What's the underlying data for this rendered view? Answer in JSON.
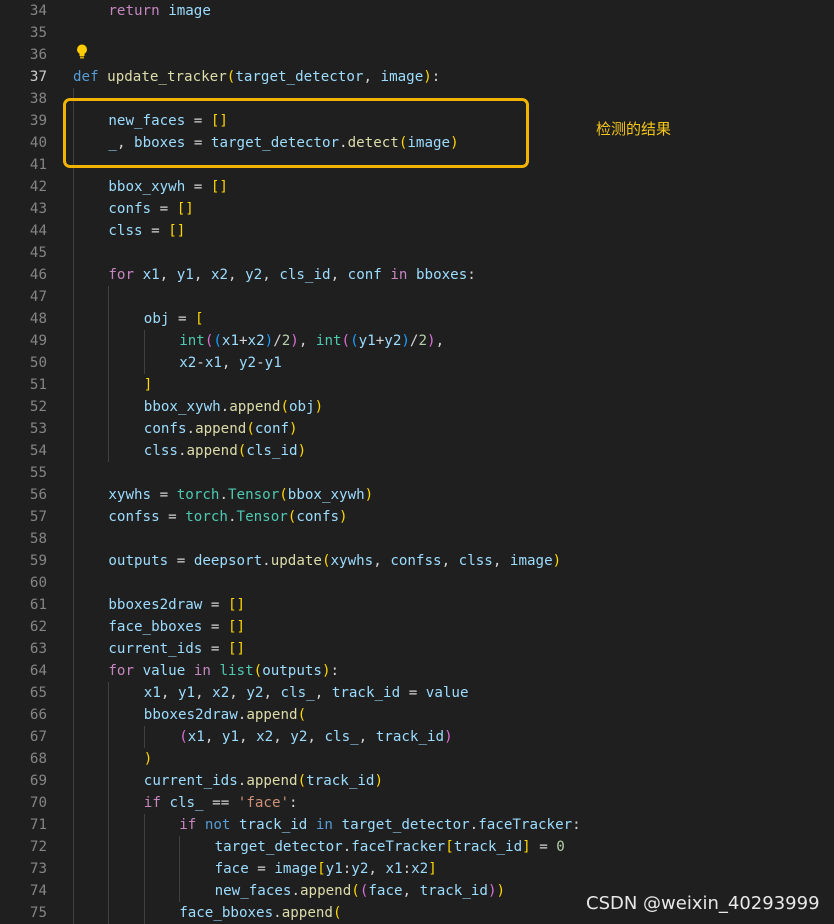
{
  "editor": {
    "theme_colors": {
      "background": "#1f1f1f",
      "keyword": "#569cd6",
      "control": "#c586c0",
      "function": "#dcdcaa",
      "variable": "#9cdcfe",
      "class": "#4ec9b0",
      "number": "#b5cea8",
      "string": "#ce9178",
      "bracket_1": "#ffd700",
      "bracket_2": "#da70d6",
      "bracket_3": "#179fff",
      "highlight_box": "#f0b400"
    },
    "active_line": 37,
    "lines": [
      {
        "n": "34",
        "indent": 1,
        "tokens": [
          [
            "ctrl",
            "return"
          ],
          [
            "op",
            " "
          ],
          [
            "var",
            "image"
          ]
        ]
      },
      {
        "n": "35",
        "indent": 0,
        "tokens": []
      },
      {
        "n": "36",
        "indent": 0,
        "tokens": []
      },
      {
        "n": "37",
        "indent": 0,
        "tokens": [
          [
            "kw",
            "def"
          ],
          [
            "op",
            " "
          ],
          [
            "fn",
            "update_tracker"
          ],
          [
            "p1",
            "("
          ],
          [
            "var",
            "target_detector"
          ],
          [
            "op",
            ", "
          ],
          [
            "var",
            "image"
          ],
          [
            "p1",
            ")"
          ],
          [
            "op",
            ":"
          ]
        ]
      },
      {
        "n": "38",
        "indent": 1,
        "tokens": []
      },
      {
        "n": "39",
        "indent": 1,
        "tokens": [
          [
            "var",
            "new_faces"
          ],
          [
            "op",
            " = "
          ],
          [
            "p1",
            "[]"
          ]
        ]
      },
      {
        "n": "40",
        "indent": 1,
        "tokens": [
          [
            "var",
            "_"
          ],
          [
            "op",
            ", "
          ],
          [
            "var",
            "bboxes"
          ],
          [
            "op",
            " = "
          ],
          [
            "var",
            "target_detector"
          ],
          [
            "op",
            "."
          ],
          [
            "fn",
            "detect"
          ],
          [
            "p1",
            "("
          ],
          [
            "var",
            "image"
          ],
          [
            "p1",
            ")"
          ]
        ]
      },
      {
        "n": "41",
        "indent": 1,
        "tokens": []
      },
      {
        "n": "42",
        "indent": 1,
        "tokens": [
          [
            "var",
            "bbox_xywh"
          ],
          [
            "op",
            " = "
          ],
          [
            "p1",
            "[]"
          ]
        ]
      },
      {
        "n": "43",
        "indent": 1,
        "tokens": [
          [
            "var",
            "confs"
          ],
          [
            "op",
            " = "
          ],
          [
            "p1",
            "[]"
          ]
        ]
      },
      {
        "n": "44",
        "indent": 1,
        "tokens": [
          [
            "var",
            "clss"
          ],
          [
            "op",
            " = "
          ],
          [
            "p1",
            "[]"
          ]
        ]
      },
      {
        "n": "45",
        "indent": 1,
        "tokens": []
      },
      {
        "n": "46",
        "indent": 1,
        "tokens": [
          [
            "ctrl",
            "for"
          ],
          [
            "op",
            " "
          ],
          [
            "var",
            "x1"
          ],
          [
            "op",
            ", "
          ],
          [
            "var",
            "y1"
          ],
          [
            "op",
            ", "
          ],
          [
            "var",
            "x2"
          ],
          [
            "op",
            ", "
          ],
          [
            "var",
            "y2"
          ],
          [
            "op",
            ", "
          ],
          [
            "var",
            "cls_id"
          ],
          [
            "op",
            ", "
          ],
          [
            "var",
            "conf"
          ],
          [
            "op",
            " "
          ],
          [
            "ctrl",
            "in"
          ],
          [
            "op",
            " "
          ],
          [
            "var",
            "bboxes"
          ],
          [
            "op",
            ":"
          ]
        ]
      },
      {
        "n": "47",
        "indent": 2,
        "tokens": []
      },
      {
        "n": "48",
        "indent": 2,
        "tokens": [
          [
            "var",
            "obj"
          ],
          [
            "op",
            " = "
          ],
          [
            "p1",
            "["
          ]
        ]
      },
      {
        "n": "49",
        "indent": 3,
        "tokens": [
          [
            "cls",
            "int"
          ],
          [
            "p2",
            "("
          ],
          [
            "p3",
            "("
          ],
          [
            "var",
            "x1"
          ],
          [
            "op",
            "+"
          ],
          [
            "var",
            "x2"
          ],
          [
            "p3",
            ")"
          ],
          [
            "op",
            "/"
          ],
          [
            "num",
            "2"
          ],
          [
            "p2",
            ")"
          ],
          [
            "op",
            ", "
          ],
          [
            "cls",
            "int"
          ],
          [
            "p2",
            "("
          ],
          [
            "p3",
            "("
          ],
          [
            "var",
            "y1"
          ],
          [
            "op",
            "+"
          ],
          [
            "var",
            "y2"
          ],
          [
            "p3",
            ")"
          ],
          [
            "op",
            "/"
          ],
          [
            "num",
            "2"
          ],
          [
            "p2",
            ")"
          ],
          [
            "op",
            ","
          ]
        ]
      },
      {
        "n": "50",
        "indent": 3,
        "tokens": [
          [
            "var",
            "x2"
          ],
          [
            "op",
            "-"
          ],
          [
            "var",
            "x1"
          ],
          [
            "op",
            ", "
          ],
          [
            "var",
            "y2"
          ],
          [
            "op",
            "-"
          ],
          [
            "var",
            "y1"
          ]
        ]
      },
      {
        "n": "51",
        "indent": 2,
        "tokens": [
          [
            "p1",
            "]"
          ]
        ]
      },
      {
        "n": "52",
        "indent": 2,
        "tokens": [
          [
            "var",
            "bbox_xywh"
          ],
          [
            "op",
            "."
          ],
          [
            "fn",
            "append"
          ],
          [
            "p1",
            "("
          ],
          [
            "var",
            "obj"
          ],
          [
            "p1",
            ")"
          ]
        ]
      },
      {
        "n": "53",
        "indent": 2,
        "tokens": [
          [
            "var",
            "confs"
          ],
          [
            "op",
            "."
          ],
          [
            "fn",
            "append"
          ],
          [
            "p1",
            "("
          ],
          [
            "var",
            "conf"
          ],
          [
            "p1",
            ")"
          ]
        ]
      },
      {
        "n": "54",
        "indent": 2,
        "tokens": [
          [
            "var",
            "clss"
          ],
          [
            "op",
            "."
          ],
          [
            "fn",
            "append"
          ],
          [
            "p1",
            "("
          ],
          [
            "var",
            "cls_id"
          ],
          [
            "p1",
            ")"
          ]
        ]
      },
      {
        "n": "55",
        "indent": 1,
        "tokens": []
      },
      {
        "n": "56",
        "indent": 1,
        "tokens": [
          [
            "var",
            "xywhs"
          ],
          [
            "op",
            " = "
          ],
          [
            "cls",
            "torch"
          ],
          [
            "op",
            "."
          ],
          [
            "cls",
            "Tensor"
          ],
          [
            "p1",
            "("
          ],
          [
            "var",
            "bbox_xywh"
          ],
          [
            "p1",
            ")"
          ]
        ]
      },
      {
        "n": "57",
        "indent": 1,
        "tokens": [
          [
            "var",
            "confss"
          ],
          [
            "op",
            " = "
          ],
          [
            "cls",
            "torch"
          ],
          [
            "op",
            "."
          ],
          [
            "cls",
            "Tensor"
          ],
          [
            "p1",
            "("
          ],
          [
            "var",
            "confs"
          ],
          [
            "p1",
            ")"
          ]
        ]
      },
      {
        "n": "58",
        "indent": 1,
        "tokens": []
      },
      {
        "n": "59",
        "indent": 1,
        "tokens": [
          [
            "var",
            "outputs"
          ],
          [
            "op",
            " = "
          ],
          [
            "var",
            "deepsort"
          ],
          [
            "op",
            "."
          ],
          [
            "fn",
            "update"
          ],
          [
            "p1",
            "("
          ],
          [
            "var",
            "xywhs"
          ],
          [
            "op",
            ", "
          ],
          [
            "var",
            "confss"
          ],
          [
            "op",
            ", "
          ],
          [
            "var",
            "clss"
          ],
          [
            "op",
            ", "
          ],
          [
            "var",
            "image"
          ],
          [
            "p1",
            ")"
          ]
        ]
      },
      {
        "n": "60",
        "indent": 1,
        "tokens": []
      },
      {
        "n": "61",
        "indent": 1,
        "tokens": [
          [
            "var",
            "bboxes2draw"
          ],
          [
            "op",
            " = "
          ],
          [
            "p1",
            "[]"
          ]
        ]
      },
      {
        "n": "62",
        "indent": 1,
        "tokens": [
          [
            "var",
            "face_bboxes"
          ],
          [
            "op",
            " = "
          ],
          [
            "p1",
            "[]"
          ]
        ]
      },
      {
        "n": "63",
        "indent": 1,
        "tokens": [
          [
            "var",
            "current_ids"
          ],
          [
            "op",
            " = "
          ],
          [
            "p1",
            "[]"
          ]
        ]
      },
      {
        "n": "64",
        "indent": 1,
        "tokens": [
          [
            "ctrl",
            "for"
          ],
          [
            "op",
            " "
          ],
          [
            "var",
            "value"
          ],
          [
            "op",
            " "
          ],
          [
            "ctrl",
            "in"
          ],
          [
            "op",
            " "
          ],
          [
            "cls",
            "list"
          ],
          [
            "p1",
            "("
          ],
          [
            "var",
            "outputs"
          ],
          [
            "p1",
            ")"
          ],
          [
            "op",
            ":"
          ]
        ]
      },
      {
        "n": "65",
        "indent": 2,
        "tokens": [
          [
            "var",
            "x1"
          ],
          [
            "op",
            ", "
          ],
          [
            "var",
            "y1"
          ],
          [
            "op",
            ", "
          ],
          [
            "var",
            "x2"
          ],
          [
            "op",
            ", "
          ],
          [
            "var",
            "y2"
          ],
          [
            "op",
            ", "
          ],
          [
            "var",
            "cls_"
          ],
          [
            "op",
            ", "
          ],
          [
            "var",
            "track_id"
          ],
          [
            "op",
            " = "
          ],
          [
            "var",
            "value"
          ]
        ]
      },
      {
        "n": "66",
        "indent": 2,
        "tokens": [
          [
            "var",
            "bboxes2draw"
          ],
          [
            "op",
            "."
          ],
          [
            "fn",
            "append"
          ],
          [
            "p1",
            "("
          ]
        ]
      },
      {
        "n": "67",
        "indent": 3,
        "tokens": [
          [
            "p2",
            "("
          ],
          [
            "var",
            "x1"
          ],
          [
            "op",
            ", "
          ],
          [
            "var",
            "y1"
          ],
          [
            "op",
            ", "
          ],
          [
            "var",
            "x2"
          ],
          [
            "op",
            ", "
          ],
          [
            "var",
            "y2"
          ],
          [
            "op",
            ", "
          ],
          [
            "var",
            "cls_"
          ],
          [
            "op",
            ", "
          ],
          [
            "var",
            "track_id"
          ],
          [
            "p2",
            ")"
          ]
        ]
      },
      {
        "n": "68",
        "indent": 2,
        "tokens": [
          [
            "p1",
            ")"
          ]
        ]
      },
      {
        "n": "69",
        "indent": 2,
        "tokens": [
          [
            "var",
            "current_ids"
          ],
          [
            "op",
            "."
          ],
          [
            "fn",
            "append"
          ],
          [
            "p1",
            "("
          ],
          [
            "var",
            "track_id"
          ],
          [
            "p1",
            ")"
          ]
        ]
      },
      {
        "n": "70",
        "indent": 2,
        "tokens": [
          [
            "ctrl",
            "if"
          ],
          [
            "op",
            " "
          ],
          [
            "var",
            "cls_"
          ],
          [
            "op",
            " == "
          ],
          [
            "str",
            "'face'"
          ],
          [
            "op",
            ":"
          ]
        ]
      },
      {
        "n": "71",
        "indent": 3,
        "tokens": [
          [
            "ctrl",
            "if"
          ],
          [
            "op",
            " "
          ],
          [
            "kw",
            "not"
          ],
          [
            "op",
            " "
          ],
          [
            "var",
            "track_id"
          ],
          [
            "op",
            " "
          ],
          [
            "kw",
            "in"
          ],
          [
            "op",
            " "
          ],
          [
            "var",
            "target_detector"
          ],
          [
            "op",
            "."
          ],
          [
            "var",
            "faceTracker"
          ],
          [
            "op",
            ":"
          ]
        ]
      },
      {
        "n": "72",
        "indent": 4,
        "tokens": [
          [
            "var",
            "target_detector"
          ],
          [
            "op",
            "."
          ],
          [
            "var",
            "faceTracker"
          ],
          [
            "p1",
            "["
          ],
          [
            "var",
            "track_id"
          ],
          [
            "p1",
            "]"
          ],
          [
            "op",
            " = "
          ],
          [
            "num",
            "0"
          ]
        ]
      },
      {
        "n": "73",
        "indent": 4,
        "tokens": [
          [
            "var",
            "face"
          ],
          [
            "op",
            " = "
          ],
          [
            "var",
            "image"
          ],
          [
            "p1",
            "["
          ],
          [
            "var",
            "y1"
          ],
          [
            "op",
            ":"
          ],
          [
            "var",
            "y2"
          ],
          [
            "op",
            ", "
          ],
          [
            "var",
            "x1"
          ],
          [
            "op",
            ":"
          ],
          [
            "var",
            "x2"
          ],
          [
            "p1",
            "]"
          ]
        ]
      },
      {
        "n": "74",
        "indent": 4,
        "tokens": [
          [
            "var",
            "new_faces"
          ],
          [
            "op",
            "."
          ],
          [
            "fn",
            "append"
          ],
          [
            "p1",
            "("
          ],
          [
            "p2",
            "("
          ],
          [
            "var",
            "face"
          ],
          [
            "op",
            ", "
          ],
          [
            "var",
            "track_id"
          ],
          [
            "p2",
            ")"
          ],
          [
            "p1",
            ")"
          ]
        ]
      },
      {
        "n": "75",
        "indent": 3,
        "tokens": [
          [
            "var",
            "face_bboxes"
          ],
          [
            "op",
            "."
          ],
          [
            "fn",
            "append"
          ],
          [
            "p1",
            "("
          ]
        ]
      }
    ]
  },
  "annotation": {
    "text": "检测的结果"
  },
  "watermark": {
    "text": "CSDN @weixin_40293999"
  },
  "icons": {
    "gutter": "lightbulb-icon"
  }
}
